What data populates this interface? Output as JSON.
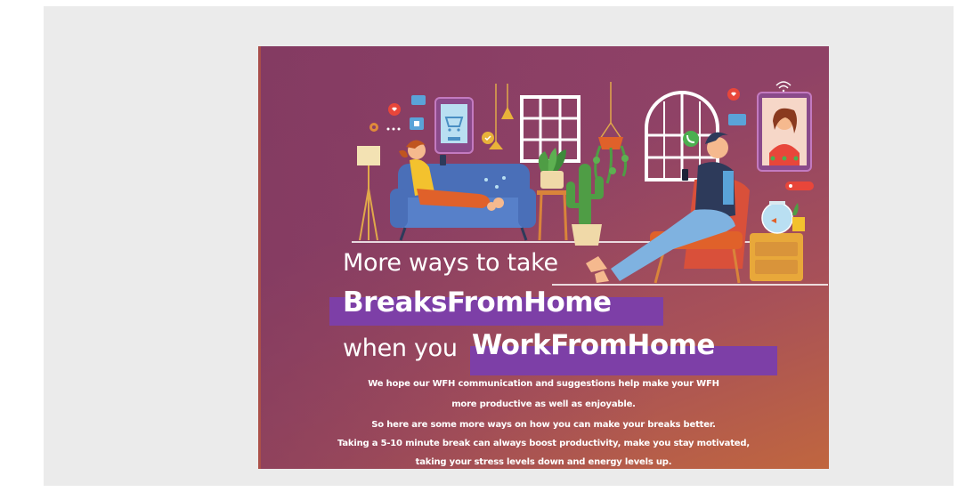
{
  "poster": {
    "headline_line1": "More ways to take",
    "headline_line2": "BreaksFromHome",
    "headline_line3_prefix": "when you",
    "headline_line3_highlight": "WorkFromHome",
    "body": {
      "p1_line1": "We hope our WFH communication and suggestions help make your WFH",
      "p1_line2": "more productive as well as enjoyable.",
      "p2_line1": "So here are some more ways on how you can make your breaks better.",
      "p2_line2": "Taking a 5-10 minute break can always boost productivity, make you stay motivated,",
      "p2_line3": "taking your stress levels down and energy levels up."
    },
    "colors": {
      "background_top": "#8c3f66",
      "background_bottom": "#c0663f",
      "highlight": "#7d3fa7",
      "text": "#ffffff"
    },
    "icons": [
      "floor-lamp-icon",
      "sofa-icon",
      "tablet-shopping-cart-icon",
      "window-icon",
      "hanging-plant-icon",
      "cactus-icon",
      "arched-window-icon",
      "video-call-tablet-icon",
      "armchair-icon",
      "fishbowl-icon",
      "heart-icon",
      "chat-bubble-icon",
      "location-pin-icon",
      "phone-call-icon",
      "wifi-icon"
    ]
  }
}
